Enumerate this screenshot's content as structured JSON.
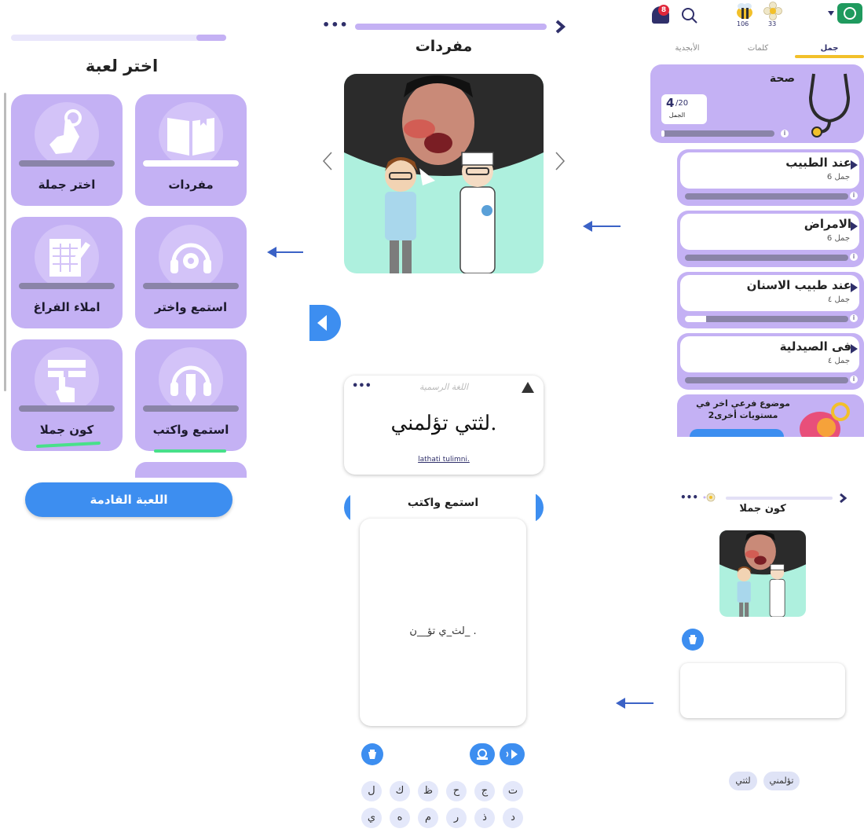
{
  "colors": {
    "primary_blue": "#3d8ef0",
    "lavender": "#c4b1f4",
    "arrow_blue": "#3b62c6",
    "green_underline": "#48e08a"
  },
  "choose_game": {
    "title": "اختر لعبة",
    "games": [
      {
        "label": "مفردات",
        "icon": "book-icon",
        "progress": 1.0,
        "underlined": false
      },
      {
        "label": "اختر جملة",
        "icon": "tap-hand-icon",
        "progress": 0.0,
        "underlined": false
      },
      {
        "label": "استمع واختر",
        "icon": "headphones-icon",
        "progress": 0.0,
        "underlined": false
      },
      {
        "label": "املاء الفراغ",
        "icon": "fill-blank-icon",
        "progress": 0.0,
        "underlined": false
      },
      {
        "label": "استمع واكتب",
        "icon": "headphones-pencil-icon",
        "progress": 0.0,
        "underlined": true
      },
      {
        "label": "كون جملا",
        "icon": "build-sentence-icon",
        "progress": 0.0,
        "underlined": true
      }
    ],
    "next_button": "اللعبة القادمة"
  },
  "vocab": {
    "title": "مفردات",
    "menu_glyph": "•••",
    "official_language_label": "اللغة الرسمية",
    "arabic_sentence": "لثتي تؤلمني.",
    "transliteration": "lathati tulimni."
  },
  "listen_write": {
    "title": "استمع واكتب",
    "prompt": "لث_ي تؤ__ن_ .",
    "keyboard_rows": [
      [
        "ت",
        "ج",
        "ح",
        "ظ",
        "ك",
        "ل"
      ],
      [
        "د",
        "ذ",
        "ر",
        "م",
        "ه",
        "ي"
      ]
    ]
  },
  "topics_screen": {
    "notification_count": "8",
    "bee_count": "106",
    "flower_count": "33",
    "tabs": [
      "جمل",
      "كلمات",
      "الأبجدية"
    ],
    "category": {
      "title": "صحة",
      "count": "4",
      "total": "/20",
      "unit": "الجمل"
    },
    "topics": [
      {
        "title": "عند الطبيب",
        "sub": "جمل 6",
        "progress": 0.0
      },
      {
        "title": "الامراض",
        "sub": "جمل 6",
        "progress": 0.0
      },
      {
        "title": "عند طبيب الاسنان",
        "sub": "جمل ٤",
        "progress": 0.13
      },
      {
        "title": "فى الصيدلية",
        "sub": "جمل ٤",
        "progress": 0.0
      }
    ],
    "promo": "موضوع فرعي اخر في مستويات أخرى2"
  },
  "build_sentence": {
    "title": "كون جملا",
    "menu_glyph": "•••",
    "words": [
      "تؤلمني",
      "لثتي"
    ]
  }
}
